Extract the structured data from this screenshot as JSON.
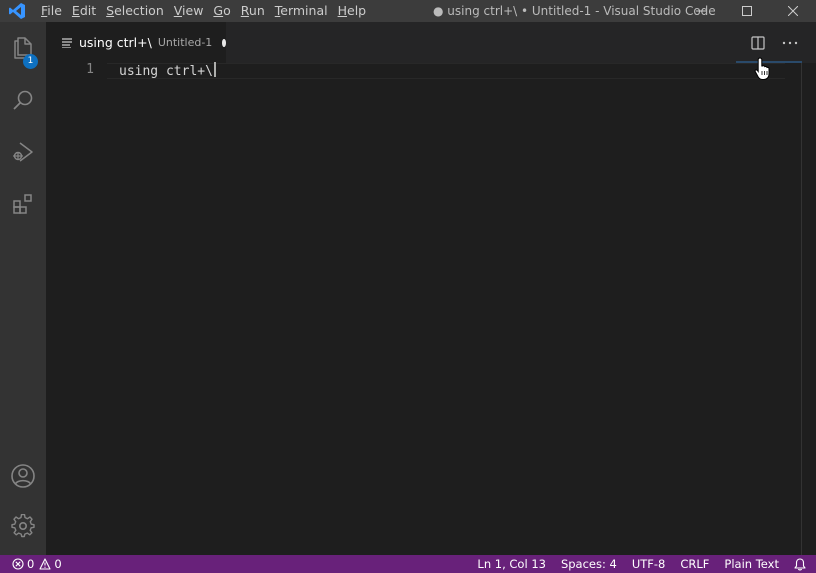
{
  "window": {
    "title": "● using ctrl+\\ • Untitled-1 - Visual Studio Code"
  },
  "menu": [
    "File",
    "Edit",
    "Selection",
    "View",
    "Go",
    "Run",
    "Terminal",
    "Help"
  ],
  "activity_bar": {
    "explorer_badge": "1",
    "icons": [
      "explorer-icon",
      "search-icon",
      "run-debug-icon",
      "extensions-icon",
      "account-icon",
      "gear-icon"
    ]
  },
  "tab": {
    "title": "using ctrl+\\",
    "description": "Untitled-1"
  },
  "editor": {
    "line_number": "1",
    "code": "using ctrl+\\"
  },
  "statusbar": {
    "errors": "0",
    "warnings": "0",
    "position": "Ln 1, Col 13",
    "spaces": "Spaces: 4",
    "encoding": "UTF-8",
    "eol": "CRLF",
    "language": "Plain Text"
  },
  "colors": {
    "statusbar_bg": "#68217a",
    "titlebar_bg": "#3c3c3c",
    "activitybar_bg": "#333333",
    "editor_bg": "#1e1e1e",
    "badge_bg": "#0e70c0",
    "logo_blue": "#3794ff"
  }
}
